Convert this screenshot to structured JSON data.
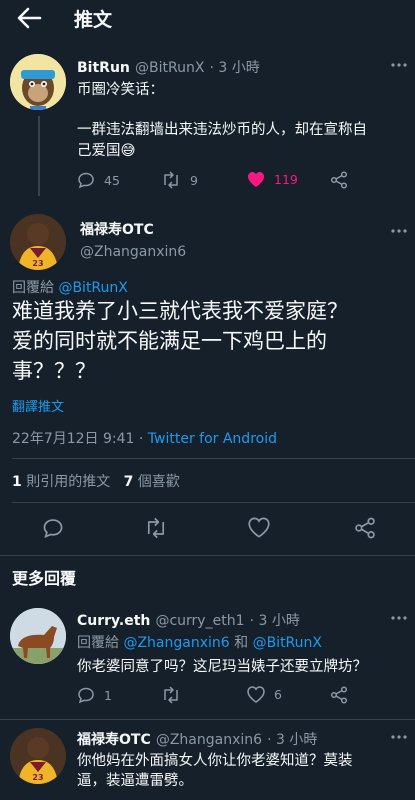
{
  "header": {
    "title": "推文"
  },
  "parent_tweet": {
    "name": "BitRun",
    "handle": "@BitRunX",
    "time": "· 3 小時",
    "line1": "币圈冷笑话：",
    "line2": "一群违法翻墙出来违法炒币的人，却在宣称自",
    "line3": "己爱国😅",
    "replies": "45",
    "retweets": "9",
    "likes": "119",
    "like_color": "#f91880"
  },
  "main_tweet": {
    "name": "福禄寿OTC",
    "handle": "@Zhanganxin6",
    "reply_prefix": "回覆給",
    "reply_to": "@BitRunX",
    "text_line1": "难道我养了小三就代表我不爱家庭？",
    "text_line2": "爱的同时就不能满足一下鸡巴上的",
    "text_line3": "事？？？",
    "translate": "翻譯推文",
    "date": "22年7月12日 9:41 · ",
    "source": "Twitter for Android",
    "quote_count": "1",
    "quote_label": "則引用的推文",
    "like_count": "7",
    "like_label": "個喜歡"
  },
  "more_replies": {
    "title": "更多回覆",
    "reply1": {
      "name": "Curry.eth",
      "handle": "@curry_eth1",
      "time": "· 3 小時",
      "reply_prefix": "回覆給",
      "reply_to_1": "@Zhanganxin6",
      "and": "和",
      "reply_to_2": "@BitRunX",
      "text": "你老婆同意了吗？这尼玛当婊子还要立牌坊？",
      "replies": "1",
      "likes": "6"
    },
    "reply2": {
      "name": "福禄寿OTC",
      "handle": "@Zhanganxin6",
      "time": "· 3 小時",
      "line1": "你他妈在外面搞女人你让你老婆知道？莫装",
      "line2": "逼，装逼遭雷劈。"
    }
  },
  "colors": {
    "background": "#15202b",
    "accent": "#1d9bf0",
    "muted": "#8b98a5",
    "like": "#f91880"
  }
}
